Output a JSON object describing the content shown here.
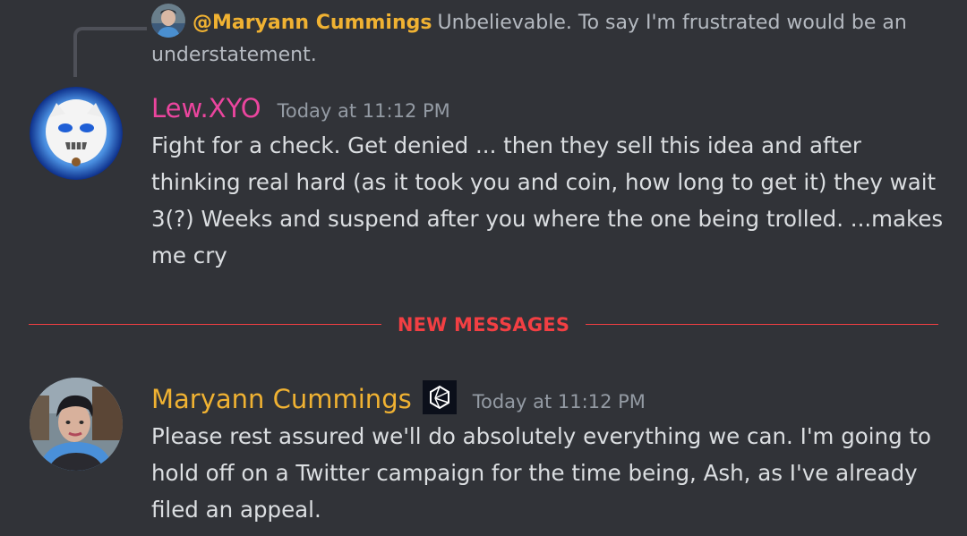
{
  "reply": {
    "author": "@Maryann Cummings",
    "text": "Unbelievable. To say I'm frustrated would be an understatement."
  },
  "messages": [
    {
      "author": "Lew.XYO",
      "timestamp": "Today at 11:12 PM",
      "content": "Fight for a check. Get denied ... then they sell this idea and after thinking real hard (as it took you and coin, how long to get it) they wait 3(?) Weeks and suspend after you where the one being trolled. ...makes me cry"
    },
    {
      "author": "Maryann Cummings",
      "timestamp": "Today at 11:12 PM",
      "content": "Please rest assured we'll do absolutely everything we can. I'm going to hold off on a Twitter campaign for the time being, Ash, as I've already filed an appeal."
    }
  ],
  "divider": {
    "label": "NEW MESSAGES"
  },
  "colors": {
    "background": "#313338",
    "lew_name": "#eb459e",
    "maryann_name": "#f0b232",
    "new_messages": "#f23f43",
    "text": "#dbdee1",
    "muted": "#949ba4"
  },
  "icons": {
    "role_badge": "hexagon-icon"
  }
}
